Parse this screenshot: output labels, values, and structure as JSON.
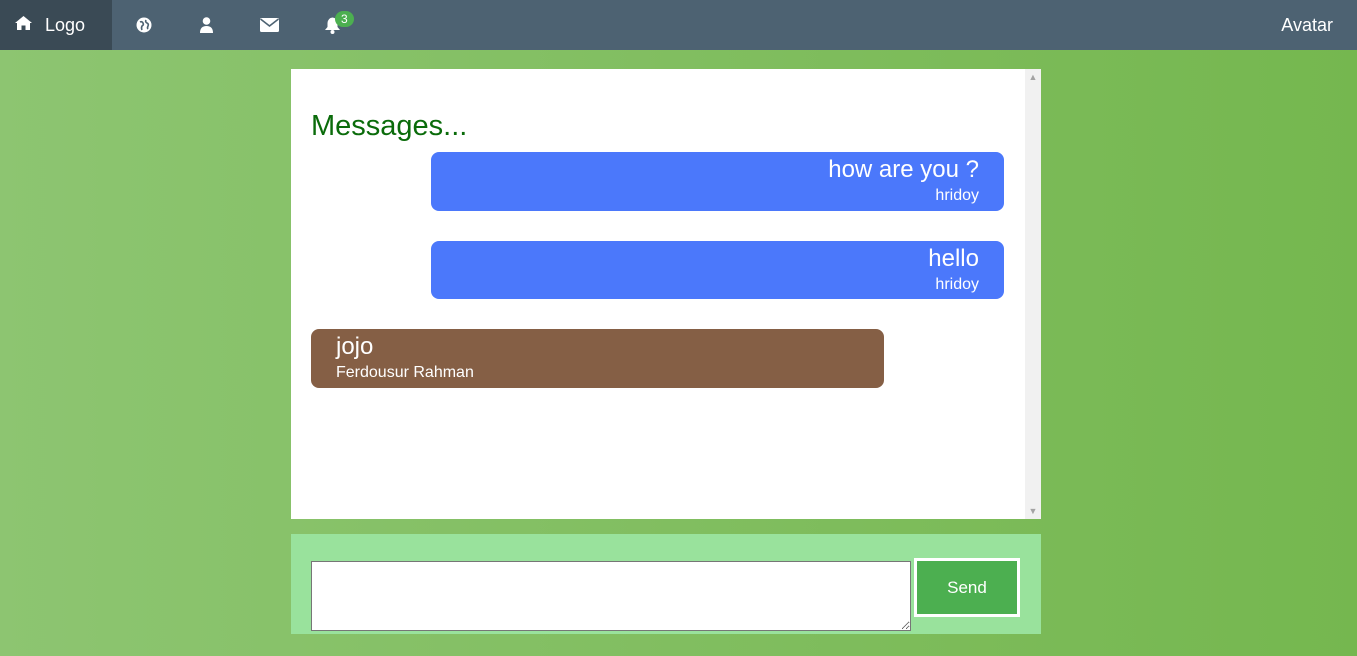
{
  "nav": {
    "logo_label": "Logo",
    "notifications_badge": "3",
    "avatar_label": "Avatar",
    "icons": [
      "home-icon",
      "globe-icon",
      "user-icon",
      "envelope-icon",
      "bell-icon"
    ]
  },
  "messages": {
    "title": "Messages...",
    "items": [
      {
        "text": "how are you ?",
        "author": "hridoy",
        "side": "mine"
      },
      {
        "text": "hello",
        "author": "hridoy",
        "side": "mine"
      },
      {
        "text": "jojo",
        "author": "Ferdousur Rahman",
        "side": "theirs"
      }
    ]
  },
  "composer": {
    "input_value": "",
    "send_label": "Send"
  },
  "colors": {
    "navbar": "#4d6272",
    "mine_bubble": "#4b78fb",
    "theirs_bubble": "#855f45",
    "send_button": "#4caf50",
    "title": "#0a6b0a"
  }
}
